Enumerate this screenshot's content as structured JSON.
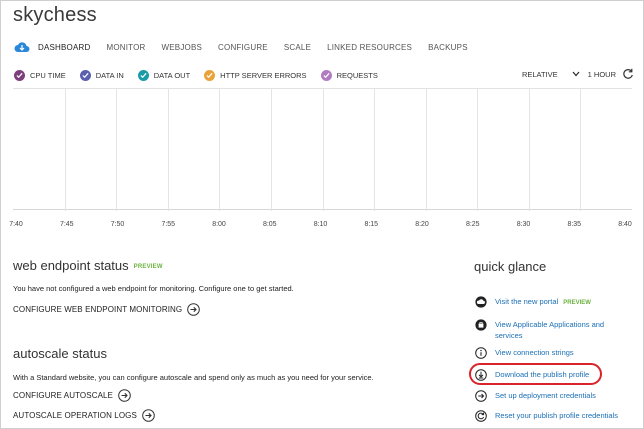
{
  "app": {
    "title": "skychess"
  },
  "nav": {
    "tabs": [
      {
        "label": "DASHBOARD",
        "active": true
      },
      {
        "label": "MONITOR"
      },
      {
        "label": "WEBJOBS"
      },
      {
        "label": "CONFIGURE"
      },
      {
        "label": "SCALE"
      },
      {
        "label": "LINKED RESOURCES"
      },
      {
        "label": "BACKUPS"
      }
    ]
  },
  "metrics": [
    {
      "label": "CPU TIME",
      "color": "#7e3f7e"
    },
    {
      "label": "DATA IN",
      "color": "#5a5fb0"
    },
    {
      "label": "DATA OUT",
      "color": "#1a9ba6"
    },
    {
      "label": "HTTP SERVER ERRORS",
      "color": "#e8a33b"
    },
    {
      "label": "REQUESTS",
      "color": "#b07cc0"
    }
  ],
  "controls": {
    "mode": "RELATIVE",
    "range": "1 HOUR"
  },
  "chart": {
    "x_labels": [
      "7:40",
      "7:45",
      "7:50",
      "7:55",
      "8:00",
      "8:05",
      "8:10",
      "8:15",
      "8:20",
      "8:25",
      "8:30",
      "8:35",
      "8:40"
    ]
  },
  "web_endpoint": {
    "heading": "web endpoint status",
    "badge": "PREVIEW",
    "text": "You have not configured a web endpoint for monitoring. Configure one to get started.",
    "action": "CONFIGURE WEB ENDPOINT MONITORING"
  },
  "autoscale": {
    "heading": "autoscale status",
    "text": "With a Standard website, you can configure autoscale and spend only as much as you need for your service.",
    "action1": "CONFIGURE AUTOSCALE",
    "action2": "AUTOSCALE OPERATION LOGS"
  },
  "quick_glance": {
    "heading": "quick glance",
    "items": [
      {
        "label": "Visit the new portal",
        "badge": "PREVIEW",
        "icon": "cloud-icon"
      },
      {
        "label": "View Applicable Applications and services",
        "icon": "bag-icon"
      },
      {
        "label": "View connection strings",
        "icon": "info-icon"
      },
      {
        "label": "Download the publish profile",
        "icon": "download-icon"
      },
      {
        "label": "Set up deployment credentials",
        "icon": "arrow-circle-icon"
      },
      {
        "label": "Reset your publish profile credentials",
        "icon": "reset-icon"
      }
    ]
  },
  "colors": {
    "link": "#1a6fb5",
    "preview": "#6cb33f",
    "highlight": "#d9242b",
    "nav_cloud": "#2b88d8"
  }
}
